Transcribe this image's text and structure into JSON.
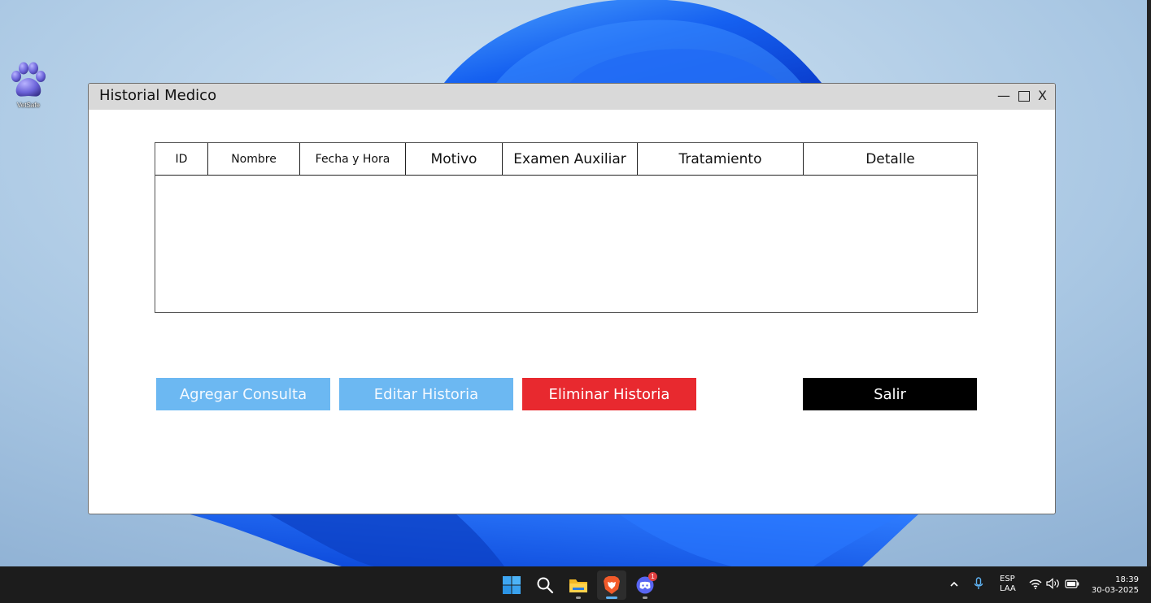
{
  "desktop": {
    "icon_label": "VetSafe"
  },
  "window": {
    "title": "Historial Medico",
    "minimize_label": "—",
    "close_label": "X"
  },
  "table": {
    "columns": [
      "ID",
      "Nombre",
      "Fecha y Hora",
      "Motivo",
      "Examen Auxiliar",
      "Tratamiento",
      "Detalle"
    ],
    "rows": []
  },
  "buttons": {
    "add": "Agregar Consulta",
    "edit": "Editar Historia",
    "delete": "Eliminar Historia",
    "exit": "Salir"
  },
  "colors": {
    "button_blue": "#6cb8f2",
    "button_red": "#e8292f",
    "button_black": "#000000",
    "titlebar": "#d9d9d9"
  },
  "taskbar": {
    "apps": [
      "start-icon",
      "search-icon",
      "file-explorer-icon",
      "brave-icon",
      "discord-icon"
    ],
    "discord_badge": "1",
    "language_line1": "ESP",
    "language_line2": "LAA",
    "time": "18:39",
    "date": "30-03-2025"
  }
}
